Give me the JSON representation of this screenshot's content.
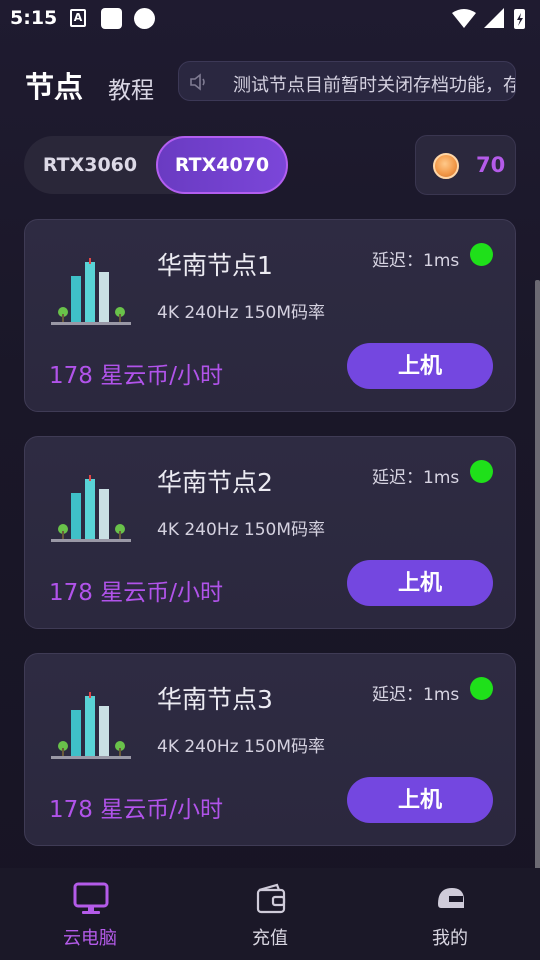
{
  "status_bar": {
    "time": "5:15",
    "a_icon_letter": "A"
  },
  "header": {
    "tab_active": "节点",
    "tab_other": "教程",
    "notice_text": "测试节点目前暂时关闭存档功能，存"
  },
  "gpu_switch": {
    "options": [
      "RTX3060",
      "RTX4070"
    ],
    "selected": "RTX4070"
  },
  "coins": {
    "value": "70"
  },
  "nodes": [
    {
      "title": "华南节点1",
      "delay": "延迟：1ms",
      "spec": "4K 240Hz 150M码率",
      "price": "178 星云币/小时",
      "button": "上机",
      "status_color": "#1fe01a"
    },
    {
      "title": "华南节点2",
      "delay": "延迟：1ms",
      "spec": "4K 240Hz 150M码率",
      "price": "178 星云币/小时",
      "button": "上机",
      "status_color": "#1fe01a"
    },
    {
      "title": "华南节点3",
      "delay": "延迟：1ms",
      "spec": "4K 240Hz 150M码率",
      "price": "178 星云币/小时",
      "button": "上机",
      "status_color": "#1fe01a"
    }
  ],
  "bottom_nav": {
    "items": [
      {
        "label": "云电脑",
        "icon": "monitor-icon",
        "active": true
      },
      {
        "label": "充值",
        "icon": "wallet-icon",
        "active": false
      },
      {
        "label": "我的",
        "icon": "helmet-icon",
        "active": false
      }
    ]
  },
  "colors": {
    "accent": "#b45be9",
    "button": "#7447e0",
    "status_online": "#1fe01a",
    "background": "#1c1929"
  }
}
